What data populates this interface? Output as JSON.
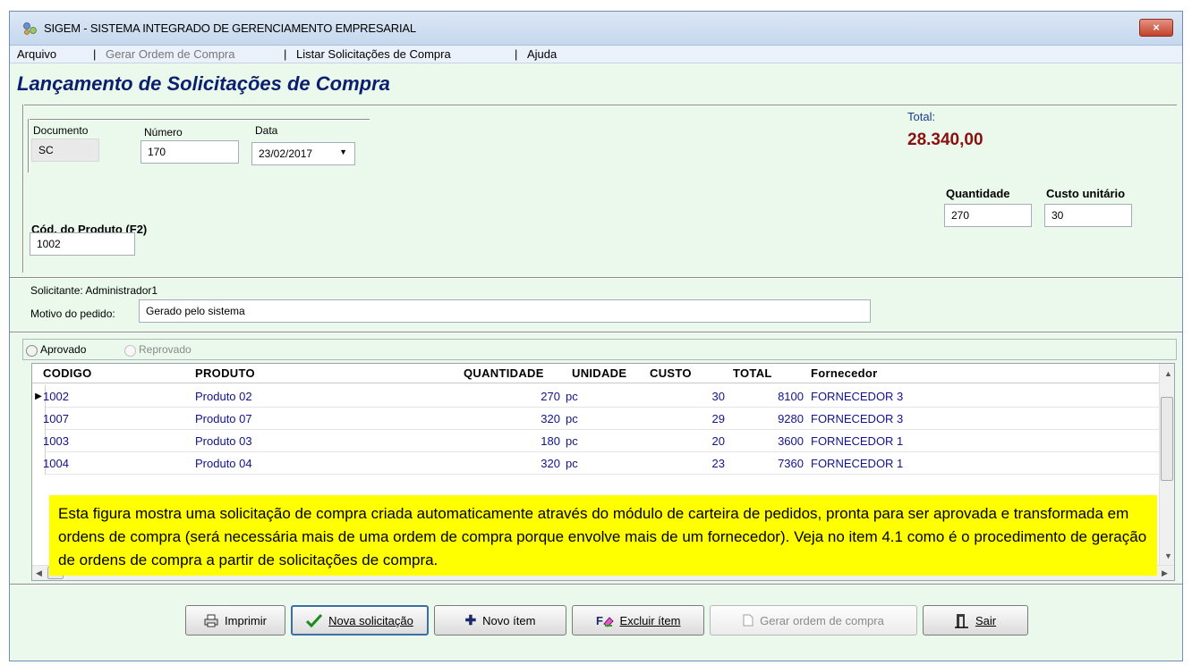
{
  "window": {
    "title": "SIGEM - SISTEMA INTEGRADO DE GERENCIAMENTO EMPRESARIAL",
    "close": "×"
  },
  "menu": {
    "items": [
      "Arquivo",
      "Gerar Ordem de Compra",
      "Listar Solicitações de Compra",
      "Ajuda"
    ],
    "separator": "|"
  },
  "form": {
    "title": "Lançamento de Solicitações de Compra",
    "documento_label": "Documento",
    "documento_value": "SC",
    "numero_label": "Número",
    "numero_value": "170",
    "data_label": "Data",
    "data_value": "23/02/2017",
    "total_label": "Total:",
    "total_value": "28.340,00",
    "quantidade_label": "Quantidade",
    "quantidade_value": "270",
    "custo_label": "Custo unitário",
    "custo_value": "30",
    "produto_label": "Cód. do Produto (F2)",
    "produto_value": "1002",
    "solicitante": "Solicitante: Administrador1",
    "motivo_label": "Motivo do pedido:",
    "motivo_value": "Gerado pelo sistema"
  },
  "approval": {
    "aprovado": "Aprovado",
    "reprovado": "Reprovado"
  },
  "grid": {
    "columns": [
      "CODIGO",
      "PRODUTO",
      "QUANTIDADE",
      "UNIDADE",
      "CUSTO",
      "TOTAL",
      "Fornecedor"
    ],
    "rows": [
      {
        "codigo": "1002",
        "produto": "Produto 02",
        "quantidade": "270",
        "unidade": "pc",
        "custo": "30",
        "total": "8100",
        "fornecedor": "FORNECEDOR 3"
      },
      {
        "codigo": "1007",
        "produto": "Produto 07",
        "quantidade": "320",
        "unidade": "pc",
        "custo": "29",
        "total": "9280",
        "fornecedor": "FORNECEDOR 3"
      },
      {
        "codigo": "1003",
        "produto": "Produto 03",
        "quantidade": "180",
        "unidade": "pc",
        "custo": "20",
        "total": "3600",
        "fornecedor": "FORNECEDOR 1"
      },
      {
        "codigo": "1004",
        "produto": "Produto 04",
        "quantidade": "320",
        "unidade": "pc",
        "custo": "23",
        "total": "7360",
        "fornecedor": "FORNECEDOR 1"
      }
    ]
  },
  "note": "Esta figura mostra uma solicitação de compra criada automaticamente através do módulo de carteira de pedidos, pronta para ser aprovada e transformada em ordens de compra (será necessária mais de uma ordem de compra porque envolve mais de um fornecedor). Veja no item 4.1 como é o procedimento de geração de ordens de compra a partir de solicitações de compra.",
  "buttons": {
    "imprimir": "Imprimir",
    "nova_solicitacao": "Nova solicitação",
    "novo_item": "Novo ítem",
    "excluir_item": "Excluir ítem",
    "gerar_ordem": "Gerar ordem de compra",
    "sair": "Sair"
  },
  "colors": {
    "background": "#eaf9ec",
    "title_blue": "#0c1f6e",
    "total_red": "#8a1010",
    "row_text": "#12128a",
    "note_yellow": "#ffff00"
  }
}
